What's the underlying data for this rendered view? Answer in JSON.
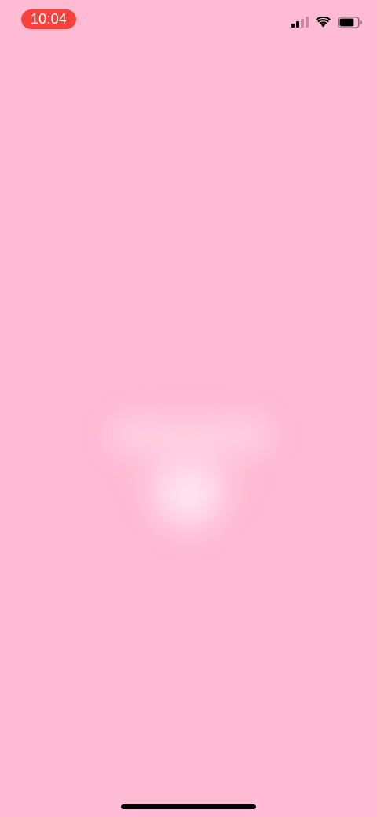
{
  "status_bar": {
    "time": "10:04",
    "time_pill_color": "#f7433d",
    "signal_icon": "cellular-signal-icon",
    "signal_bars_active": 2,
    "signal_bars_total": 4,
    "wifi_icon": "wifi-icon",
    "battery_icon": "battery-icon",
    "battery_level": 0.8
  },
  "screen": {
    "background_color": "#ffbbd3",
    "splash_icon": "blurred-app-logo"
  },
  "home_indicator": {
    "color": "#000000"
  }
}
